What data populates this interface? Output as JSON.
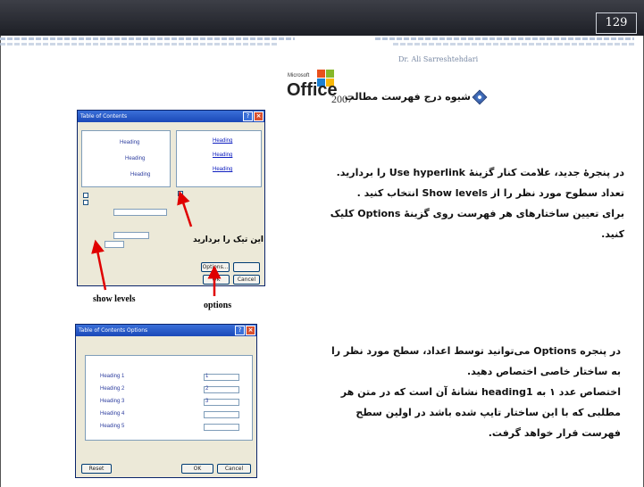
{
  "slide": {
    "page_number": "129",
    "author": "Dr. Ali Sarreshtehdari"
  },
  "logo": {
    "brand_small": "Microsoft",
    "brand": "Office",
    "year": "2007"
  },
  "heading": "شیوه درج فهرست مطالب",
  "paragraph1": {
    "line1": "در پنجرۀ جدید، علامت کنار گزینۀ Use hyperlink را برداريد.",
    "line2": "تعداد سطوح مورد نظر را از Show levels انتخاب کنید .",
    "line3": "برای تعیین ساختارهای هر فهرست روی گزینۀ Options کلیک",
    "line4": "کنید."
  },
  "paragraph2": {
    "line1": "در پنجره Options می‌توانید توسط اعداد، سطح مورد نظر را",
    "line2": "به ساختار خاصی اختصاص دهید.",
    "line3": "اختصاص عدد ۱ به heading1 نشانۀ آن است که در متن هر",
    "line4": "مطلبی که با این ساختار تایپ شده باشد در اولین سطح",
    "line5": "فهرست قرار خواهد گرفت."
  },
  "screenshot1": {
    "title": "Table of Contents",
    "heading1": "Heading",
    "heading2": "Heading",
    "heading3": "Heading",
    "ok": "OK",
    "cancel": "Cancel",
    "options": "Options..."
  },
  "screenshot2": {
    "title": "Table of Contents Options",
    "rows": [
      "Heading 1",
      "Heading 2",
      "Heading 3",
      "Heading 4",
      "Heading 5"
    ],
    "levels": [
      "1",
      "2",
      "3",
      "",
      ""
    ],
    "reset": "Reset",
    "ok": "OK",
    "cancel": "Cancel"
  },
  "captions": {
    "show_levels": "show levels",
    "options": "options",
    "remove_tick": "این تیک را بردارید"
  },
  "colors": {
    "header_bar": "#2a2c34",
    "stripe": "#b8c6dc",
    "dialog_title": "#1a48b8",
    "arrow": "#e00000"
  }
}
